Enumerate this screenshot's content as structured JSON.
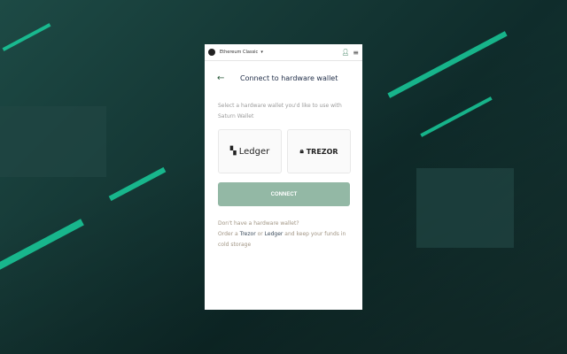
{
  "header": {
    "network": "Ethereum Classic"
  },
  "page": {
    "title": "Connect to hardware wallet",
    "description": "Select a hardware wallet you'd like to use with Saturn Wallet"
  },
  "wallets": [
    {
      "label": "Ledger"
    },
    {
      "label": "TREZOR"
    }
  ],
  "connect_label": "CONNECT",
  "footer": {
    "line1": "Don't have a hardware wallet?",
    "order": "Order a",
    "trezor": "Trezor",
    "or": "or",
    "ledger": "Ledger",
    "rest": "and keep your funds in cold storage"
  },
  "colors": {
    "accent": "#93b8a5",
    "stripe": "#19d6a3"
  }
}
